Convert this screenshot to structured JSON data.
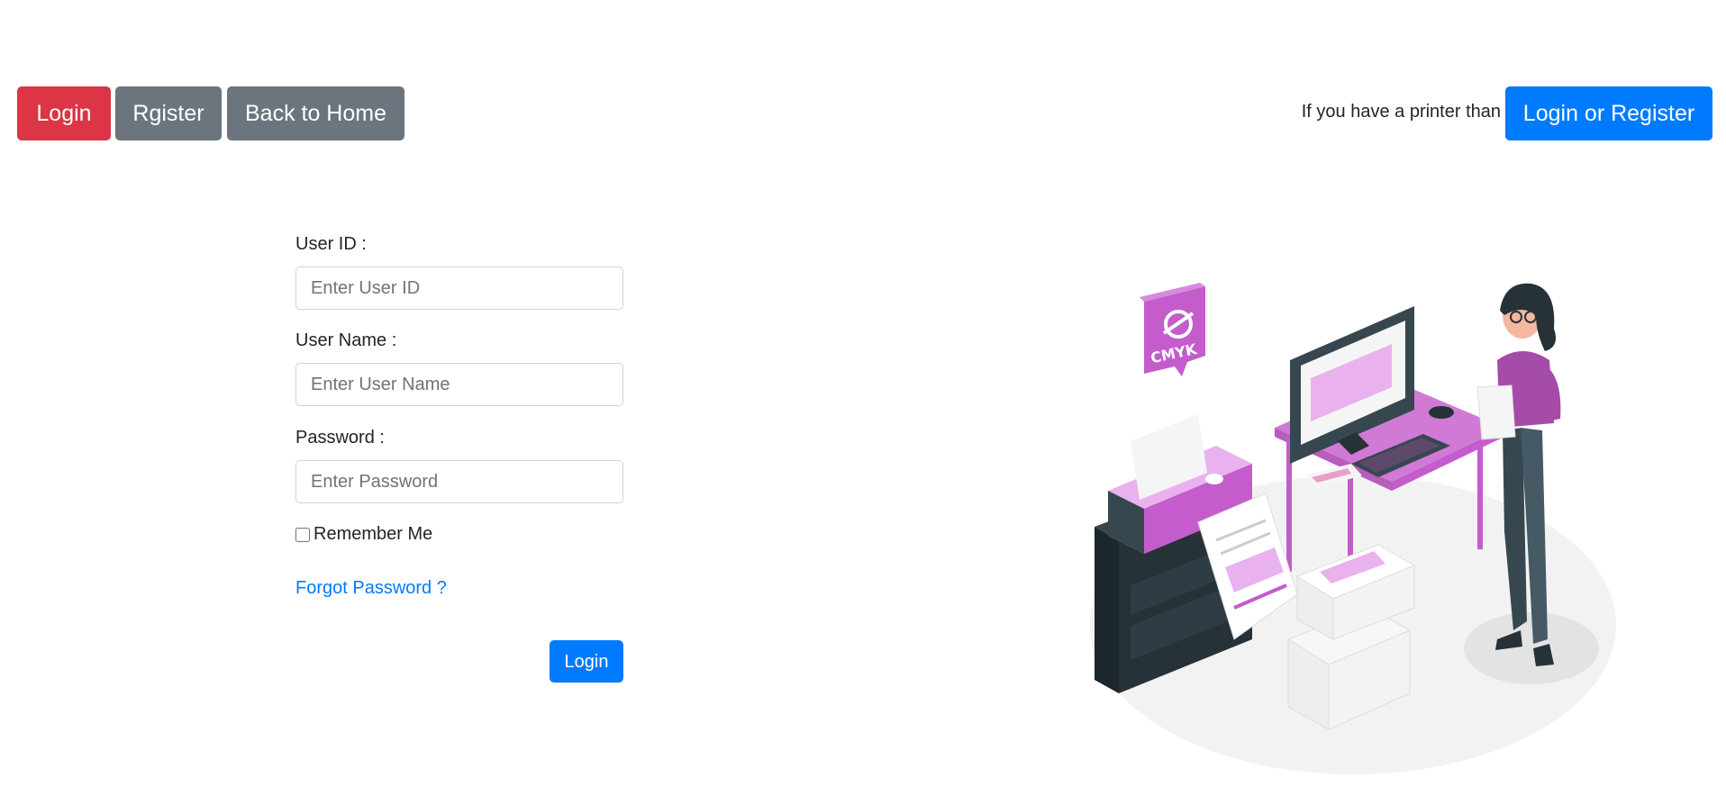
{
  "nav": {
    "login_label": "Login",
    "register_label": "Rgister",
    "home_label": "Back to Home",
    "printer_prompt": "If you have a printer than",
    "printer_button_label": "Login or Register"
  },
  "form": {
    "user_id": {
      "label": "User ID :",
      "placeholder": "Enter User ID",
      "value": ""
    },
    "user_name": {
      "label": "User Name :",
      "placeholder": "Enter User Name",
      "value": ""
    },
    "password": {
      "label": "Password :",
      "placeholder": "Enter Password",
      "value": ""
    },
    "remember_label": "Remember Me",
    "remember_checked": false,
    "forgot_label": "Forgot Password ?",
    "submit_label": "Login"
  },
  "illustration": {
    "name": "printer-workspace-illustration",
    "badge_text": "CMYK",
    "colors": {
      "accent": "#c45ccc",
      "dark": "#263238",
      "light_floor": "#ebebeb"
    }
  },
  "colors": {
    "danger": "#dc3545",
    "secondary": "#6c757d",
    "primary": "#007bff",
    "link": "#007bff"
  }
}
